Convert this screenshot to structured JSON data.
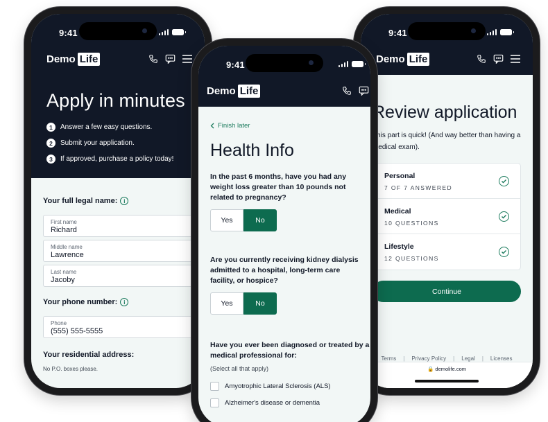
{
  "status": {
    "time": "9:41"
  },
  "brand": {
    "demo": "Demo",
    "life": "Life"
  },
  "apply": {
    "title": "Apply in minutes",
    "steps": [
      {
        "num": "1",
        "text": "Answer a few easy questions."
      },
      {
        "num": "2",
        "text": "Submit your application."
      },
      {
        "num": "3",
        "text": "If approved, purchase a policy today!"
      }
    ],
    "name_label": "Your full legal name:",
    "first": {
      "label": "First name",
      "value": "Richard"
    },
    "middle": {
      "label": "Middle name",
      "value": "Lawrence"
    },
    "last": {
      "label": "Last name",
      "value": "Jacoby"
    },
    "phone_label": "Your phone number:",
    "phone": {
      "label": "Phone",
      "value": "(555) 555-5555"
    },
    "address_label": "Your residential address:",
    "address_note": "No P.O. boxes please."
  },
  "health": {
    "finish_later": "Finish later",
    "title": "Health Info",
    "q1": "In the past 6 months, have you had any weight loss greater than 10 pounds not related to pregnancy?",
    "q2": "Are you currently receiving kidney dialysis admitted to a hospital, long-term care facility, or hospice?",
    "yes": "Yes",
    "no": "No",
    "selected": "No",
    "q3": "Have you ever been diagnosed or treated by a medical professional for:",
    "select_all": "(Select all that apply)",
    "options": [
      "Amyotrophic Lateral Sclerosis (ALS)",
      "Alzheimer's disease or dementia"
    ]
  },
  "review": {
    "title": "Review application",
    "subtitle": "This part is quick! (And way better than having a medical exam).",
    "rows": [
      {
        "title": "Personal",
        "sub": "7 OF 7 ANSWERED"
      },
      {
        "title": "Medical",
        "sub": "10 QUESTIONS"
      },
      {
        "title": "Lifestyle",
        "sub": "12 QUESTIONS"
      }
    ],
    "continue": "Continue",
    "footer": [
      "Terms",
      "Privacy Policy",
      "Legal",
      "Licenses"
    ],
    "url": "demolife.com"
  },
  "colors": {
    "navy": "#111827",
    "green": "#0d6b4f",
    "bg": "#f2f7f6"
  }
}
